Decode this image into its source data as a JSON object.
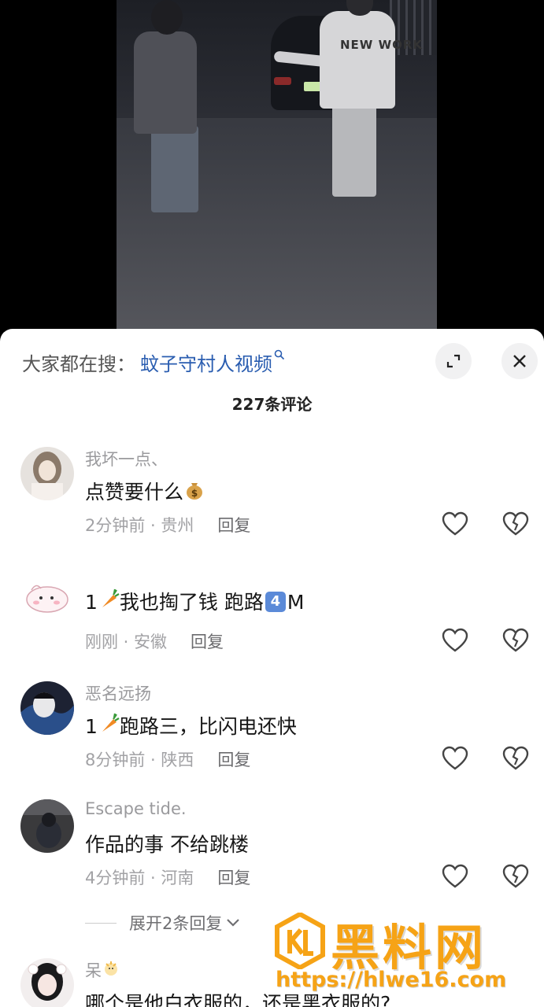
{
  "search": {
    "prefix": "大家都在搜：",
    "term": "蚊子守村人视频"
  },
  "comment_count": "227条评论",
  "comments": [
    {
      "username": "我坏一点、",
      "text": "点赞要什么",
      "emoji": "money-bag",
      "time": "2分钟前",
      "location": "贵州",
      "reply": "回复"
    },
    {
      "username": "",
      "text_before": "1",
      "emoji": "carrot",
      "text_mid": "我也掏了钱 跑路",
      "badge": "4",
      "text_after": "M",
      "time": "刚刚",
      "location": "安徽",
      "reply": "回复"
    },
    {
      "username": "恶名远扬",
      "text_before": "1",
      "emoji": "carrot",
      "text_after": "跑路三，比闪电还快",
      "time": "8分钟前",
      "location": "陕西",
      "reply": "回复"
    },
    {
      "username": "Escape tide.",
      "text": "作品的事 不给跳楼",
      "time": "4分钟前",
      "location": "河南",
      "reply": "回复"
    },
    {
      "username": "呆",
      "text": "哪个是他白衣服的，还是黑衣服的?"
    }
  ],
  "expand_replies": "展开2条回复",
  "meta_separator": " · ",
  "watermark": {
    "brand": "黑料网",
    "url": "https://hlwe16.com"
  },
  "video": {
    "shirt_text": "NEW WORK"
  },
  "colors": {
    "search_term": "#2a5db0",
    "watermark": "#f6a316",
    "badge": "#5b8ad8"
  }
}
